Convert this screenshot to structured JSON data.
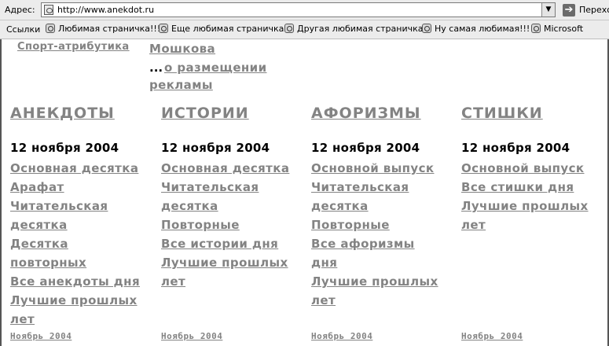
{
  "browser": {
    "address_label": "Адрес:",
    "url": "http://www.anekdot.ru",
    "go_label": "Перехо",
    "links_label": "Ссылки",
    "favorites": [
      "Любимая страничка!!!",
      "Еще любимая страничка",
      "Другая любимая страничка",
      "Ну самая любимая!!!",
      "Microsoft"
    ]
  },
  "top": {
    "sport": "Спорт-атрибутика",
    "moshkova": "Мошкова",
    "ellipsis": "...",
    "ad_line1": "о размещении",
    "ad_line2": "рекламы"
  },
  "columns": [
    {
      "title": "АНЕКДОТЫ",
      "date": "12 ноября 2004",
      "links": [
        "Основная десятка",
        "Арафат",
        "Читательская десятка",
        "Десятка повторных",
        "Все анекдоты дня",
        "Лучшие прошлых лет"
      ],
      "footer": "Ноябрь 2004"
    },
    {
      "title": "ИСТОРИИ",
      "date": "12 ноября 2004",
      "links": [
        "Основная десятка",
        "Читательская десятка",
        "Повторные",
        "Все истории дня",
        "Лучшие прошлых лет"
      ],
      "footer": "Ноябрь 2004"
    },
    {
      "title": "АФОРИЗМЫ",
      "date": "12 ноября 2004",
      "links": [
        "Основной выпуск",
        "Читательская десятка",
        "Повторные",
        "Все афоризмы дня",
        "Лучшие прошлых лет"
      ],
      "footer": "Ноябрь 2004"
    },
    {
      "title": "СТИШКИ",
      "date": "12 ноября 2004",
      "links": [
        "Основной выпуск",
        "Все стишки дня",
        "Лучшие прошлых лет"
      ],
      "footer": "Ноябрь 2004"
    }
  ],
  "icons": {
    "page": "page-icon",
    "go": "go-arrow-icon",
    "favorite": "favorite-page-icon"
  },
  "colors": {
    "link": "#838383",
    "text": "#000000",
    "toolbar": "#ececec"
  }
}
